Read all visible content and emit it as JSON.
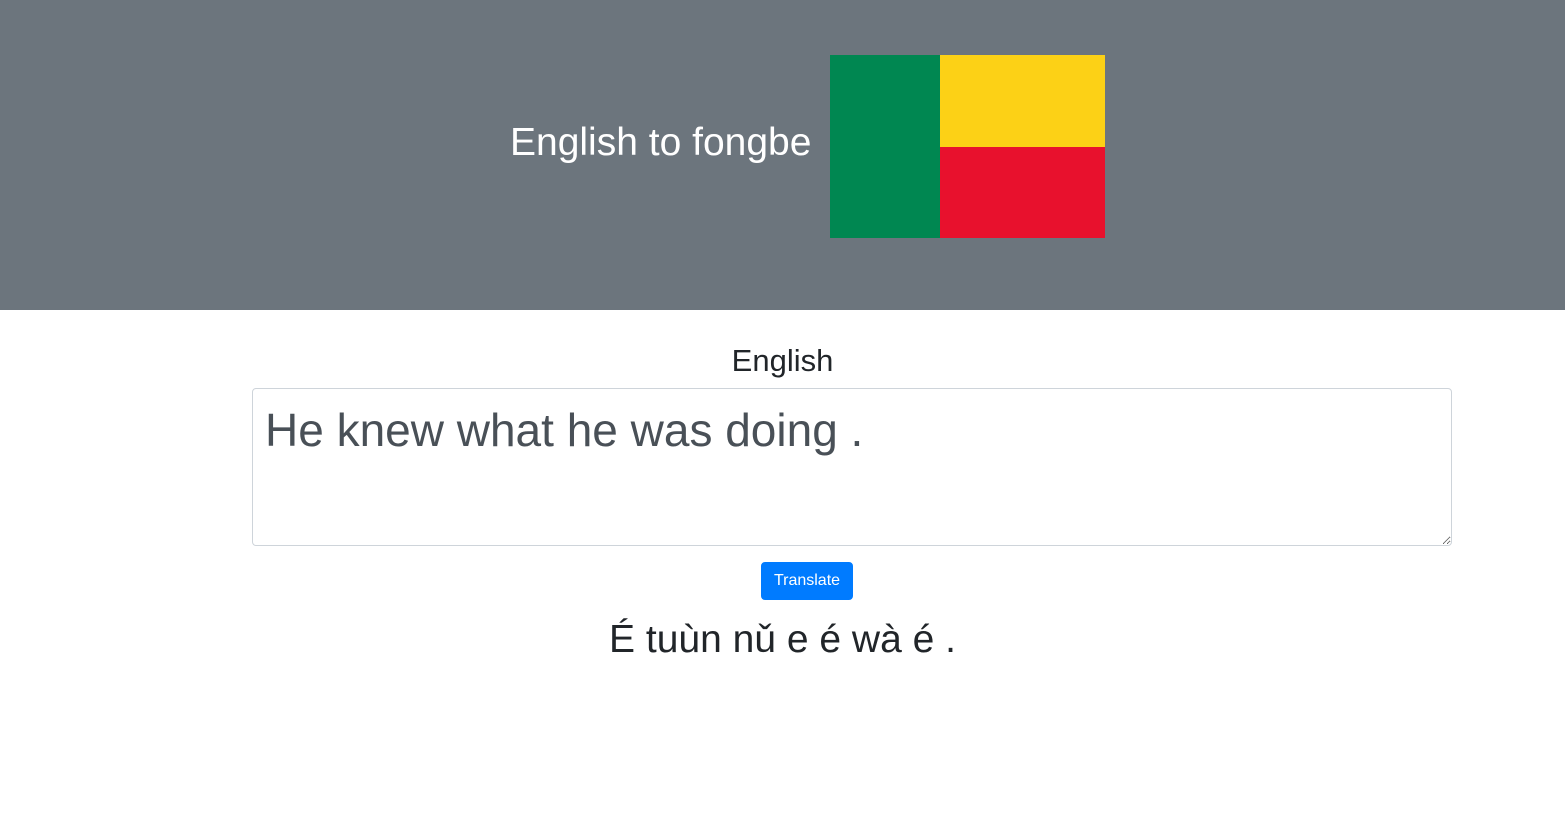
{
  "header": {
    "title": "English to fongbe",
    "flag": {
      "name": "benin-flag",
      "colors": {
        "green": "#008751",
        "yellow": "#fcd116",
        "red": "#e8112d"
      }
    },
    "background_color": "#6c757d"
  },
  "source": {
    "label": "English",
    "value": "He knew what he was doing ."
  },
  "actions": {
    "translate_label": "Translate",
    "accent_color": "#007bff"
  },
  "output": {
    "text": "É tuùn nǔ e é wà é ."
  }
}
